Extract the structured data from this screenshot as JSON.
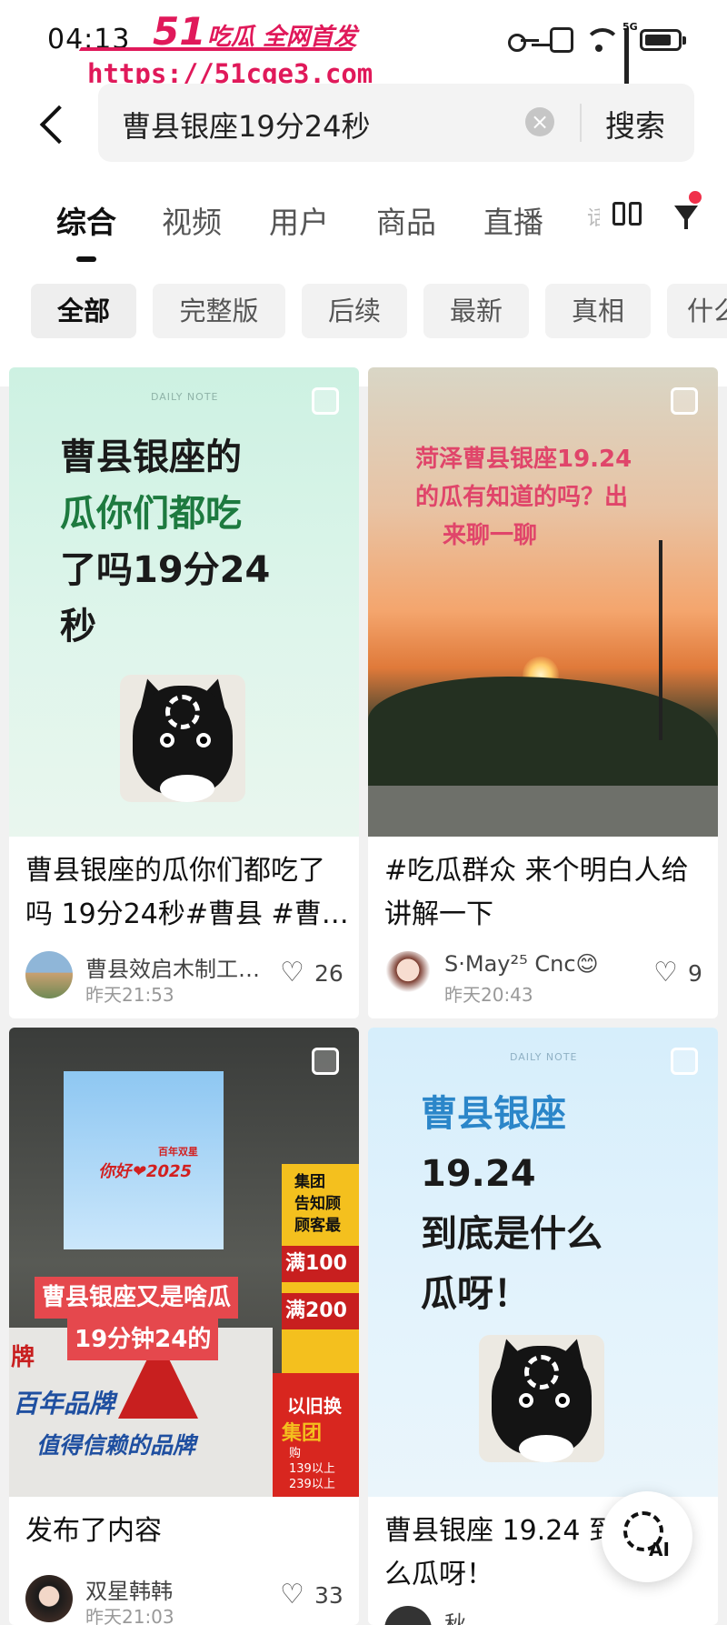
{
  "status_bar": {
    "time": "04:13",
    "network": "5G",
    "icons": [
      "key-icon",
      "vibrate-icon",
      "wifi-icon",
      "signal-icon",
      "battery-icon"
    ]
  },
  "watermark": {
    "logo": "51",
    "tagline": "吃瓜 全网首发",
    "url": "https://51cge3.com",
    "color": "#e0195a"
  },
  "search": {
    "query": "曹县银座19分24秒",
    "button_label": "搜索"
  },
  "tabs": [
    {
      "label": "综合",
      "active": true
    },
    {
      "label": "视频"
    },
    {
      "label": "用户"
    },
    {
      "label": "商品"
    },
    {
      "label": "直播"
    }
  ],
  "tab_overflow_fragment": "话",
  "chips": [
    {
      "label": "全部",
      "active": true
    },
    {
      "label": "完整版"
    },
    {
      "label": "后续"
    },
    {
      "label": "最新"
    },
    {
      "label": "真相"
    },
    {
      "label": "什么"
    }
  ],
  "cards": [
    {
      "cover_heading_lines": [
        "曹县银座的",
        "瓜你们都吃",
        "了吗19分24",
        "秒"
      ],
      "cover_badge": "DAILY NOTE",
      "title_lines": [
        "曹县银座的瓜你们都吃了",
        "吗 19分24秒#曹县 #曹…"
      ],
      "author": "曹县效启木制工…",
      "time": "昨天21:53",
      "likes": "26"
    },
    {
      "cover_heading_lines": [
        "菏泽曹县银座19.24",
        "的瓜有知道的吗？出",
        "来聊一聊"
      ],
      "title_lines": [
        "#吃瓜群众  来个明白人给",
        "讲解一下"
      ],
      "author": "S·May²⁵ Cnc😊",
      "time": "昨天20:43",
      "likes": "9"
    },
    {
      "cover_caption_lines": [
        "曹县银座又是啥瓜",
        "19分钟24的"
      ],
      "store_sign": {
        "brand_lines": [
          "你好❤2025",
          "百年双星"
        ],
        "notice_lines": [
          "集团",
          "告知顾",
          "顾客最"
        ],
        "offer1": "满100",
        "offer2": "满200",
        "banner": "以旧换",
        "banner2": "集团",
        "detail_lines": [
          "购",
          "139以上",
          "239以上"
        ],
        "slogan_lines": [
          "百年品牌",
          "值得信赖的品牌"
        ],
        "left_edge": "牌"
      },
      "title_lines": [
        "发布了内容"
      ],
      "author": "双星韩韩",
      "time": "昨天21:03",
      "likes": "33"
    },
    {
      "cover_badge": "DAILY NOTE",
      "cover_heading_lines": [
        "曹县银座",
        "19.24",
        "到底是什么",
        "瓜呀！"
      ],
      "title_lines": [
        "曹县银座 19.24 到",
        "么瓜呀！"
      ],
      "author": "秋"
    }
  ],
  "fab": {
    "label": "AI"
  }
}
